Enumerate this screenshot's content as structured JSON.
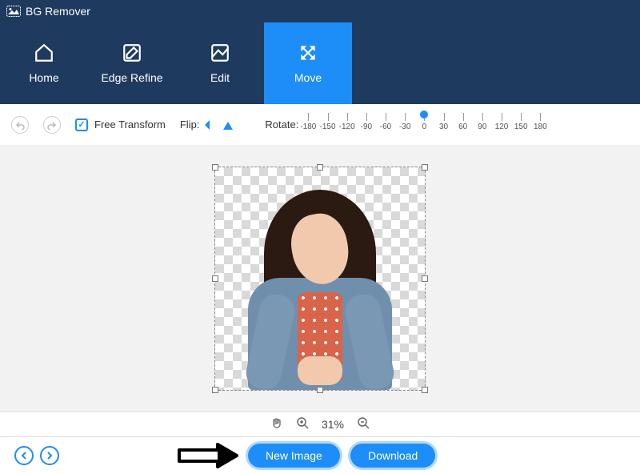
{
  "app": {
    "title": "BG Remover"
  },
  "nav": {
    "items": [
      {
        "label": "Home"
      },
      {
        "label": "Edge Refine"
      },
      {
        "label": "Edit"
      },
      {
        "label": "Move"
      }
    ],
    "active_index": 3
  },
  "toolbar": {
    "free_transform_label": "Free Transform",
    "free_transform_checked": true,
    "flip_label": "Flip:",
    "rotate_label": "Rotate:",
    "rotate_ticks": [
      "-180",
      "-150",
      "-120",
      "-90",
      "-60",
      "-30",
      "0",
      "30",
      "60",
      "90",
      "120",
      "150",
      "180"
    ],
    "rotate_value": 0
  },
  "zoom": {
    "value": "31%"
  },
  "footer": {
    "new_image_label": "New Image",
    "download_label": "Download"
  }
}
